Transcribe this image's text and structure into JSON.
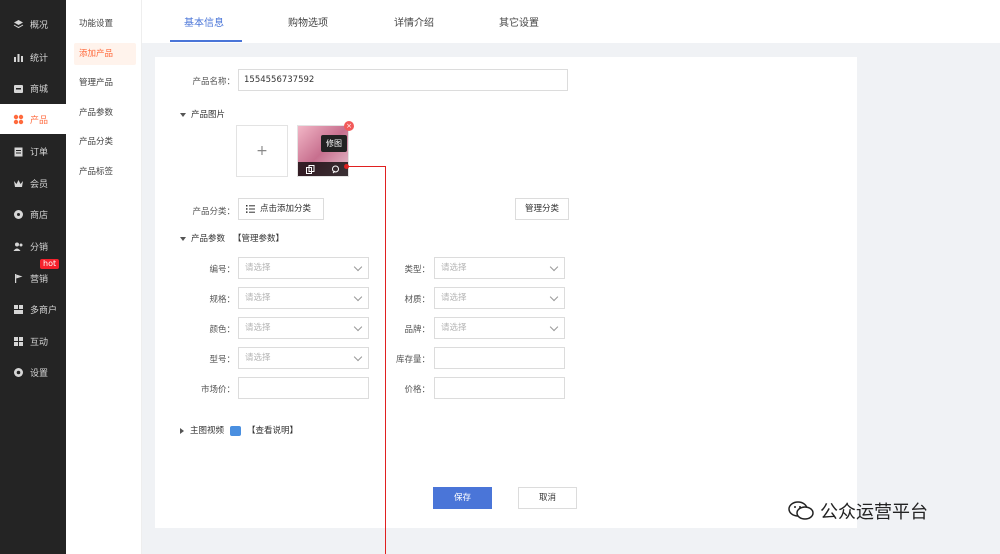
{
  "nav": {
    "items": [
      {
        "label": "概况",
        "icon": "layers-icon"
      },
      {
        "label": "统计",
        "icon": "bar-chart-icon"
      },
      {
        "label": "商城",
        "icon": "store-icon"
      },
      {
        "label": "产品",
        "icon": "grid-icon"
      },
      {
        "label": "订单",
        "icon": "clipboard-icon"
      },
      {
        "label": "会员",
        "icon": "crown-icon"
      },
      {
        "label": "商店",
        "icon": "shop-icon"
      },
      {
        "label": "分销",
        "icon": "users-icon"
      },
      {
        "label": "营销",
        "icon": "flag-icon"
      },
      {
        "label": "多商户",
        "icon": "merchant-icon"
      },
      {
        "label": "互动",
        "icon": "apps-icon"
      },
      {
        "label": "设置",
        "icon": "gear-icon"
      }
    ],
    "active_index": 3,
    "hot_badge": "hot"
  },
  "submenu": {
    "items": [
      "功能设置",
      "添加产品",
      "管理产品",
      "产品参数",
      "产品分类",
      "产品标签"
    ],
    "active_index": 1
  },
  "tabs": [
    "基本信息",
    "购物选项",
    "详情介绍",
    "其它设置"
  ],
  "form": {
    "name_label": "产品名称：",
    "name_value": "1554556737592",
    "images_section": "产品图片",
    "upload_plus": "+",
    "thumb_tooltip": "修图",
    "thumb_delete": "×",
    "category_label": "产品分类：",
    "category_button": "点击添加分类",
    "manage_category_button": "管理分类",
    "params_section": "产品参数",
    "params_manage_link": "【管理参数】",
    "fields": {
      "code_label": "编号：",
      "type_label": "类型：",
      "spec_label": "规格：",
      "material_label": "材质：",
      "color_label": "颜色：",
      "brand_label": "品牌：",
      "model_label": "型号：",
      "stock_label": "库存量：",
      "market_price_label": "市场价：",
      "price_label": "价格："
    },
    "select_placeholder": "请选择",
    "video_section": "主图视频",
    "video_help_link": "【查看说明】",
    "save_button": "保存",
    "cancel_button": "取消"
  },
  "watermark": "公众运营平台",
  "colors": {
    "accent": "#4a75d8",
    "nav_active": "#ff6a3d",
    "annotation": "#e02020"
  }
}
